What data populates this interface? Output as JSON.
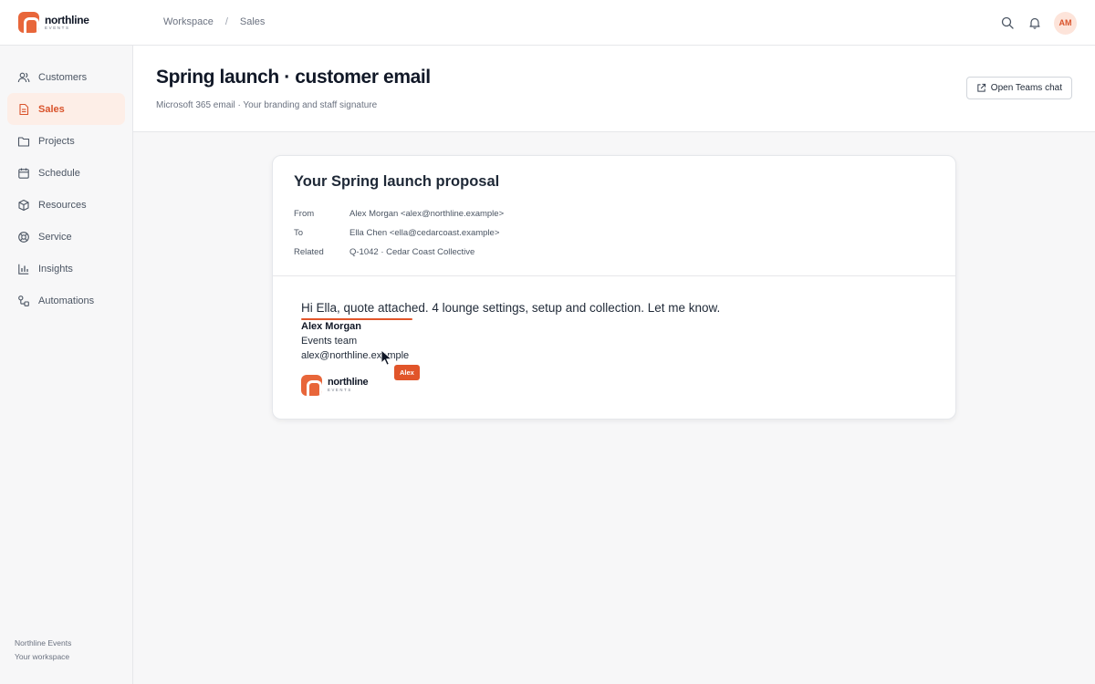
{
  "brand": {
    "name": "northline",
    "sub": "EVENTS"
  },
  "breadcrumb": {
    "items": [
      "Workspace",
      "Sales"
    ],
    "separator": "/"
  },
  "user": {
    "initials": "AM"
  },
  "sidebar": {
    "items": [
      {
        "label": "Customers",
        "icon": "users-icon"
      },
      {
        "label": "Sales",
        "icon": "document-icon",
        "active": true
      },
      {
        "label": "Projects",
        "icon": "folder-icon"
      },
      {
        "label": "Schedule",
        "icon": "calendar-icon"
      },
      {
        "label": "Resources",
        "icon": "box-icon"
      },
      {
        "label": "Service",
        "icon": "lifebuoy-icon"
      },
      {
        "label": "Insights",
        "icon": "bar-chart-icon"
      },
      {
        "label": "Automations",
        "icon": "workflow-icon"
      }
    ],
    "footer": {
      "org": "Northline Events",
      "workspace": "Your workspace"
    }
  },
  "page": {
    "title": "Spring launch · customer email",
    "subtitle": "Microsoft 365 email · Your branding and staff signature",
    "teams_button": "Open Teams chat"
  },
  "email": {
    "subject": "Your Spring launch proposal",
    "from_label": "From",
    "from_value": "Alex Morgan <alex@northline.example>",
    "to_label": "To",
    "to_value": "Ella Chen <ella@cedarcoast.example>",
    "related_label": "Related",
    "related_value": "Q-1042 · Cedar Coast Collective",
    "body": "Hi Ella, quote attached. 4 lounge settings, setup and collection. Let me know.",
    "signature": {
      "name": "Alex Morgan",
      "team": "Events team",
      "email": "alex@northline.example",
      "logo_name": "northline",
      "logo_sub": "EVENTS"
    },
    "cursor_label": "Alex"
  },
  "colors": {
    "accent": "#e8663a",
    "accent_soft": "#fdeee7"
  }
}
